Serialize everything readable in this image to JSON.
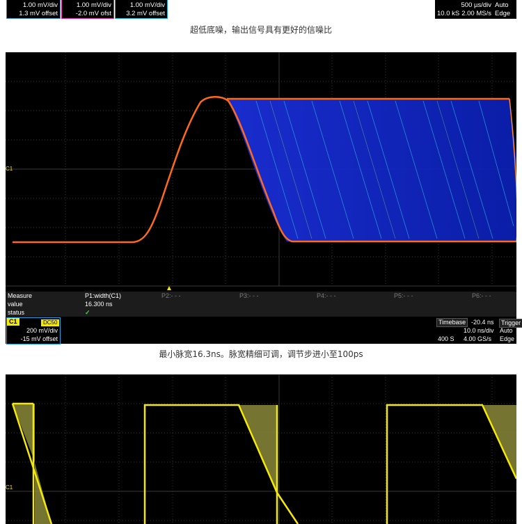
{
  "top_strip": {
    "channels": [
      {
        "line1": "1.00 mV/div",
        "line2": "1.3 mV offset",
        "border": "#3a7bd5"
      },
      {
        "line1": "1.00 mV/div",
        "line2": "-2.0 mV ofst",
        "border": "#e0208a"
      },
      {
        "line1": "1.00 mV/div",
        "line2": "3.2 mV offset",
        "border": "#1fa0e0"
      }
    ],
    "timebase": {
      "div": "500 µs/div",
      "samples": "10.0 kS",
      "rate": "2.00 MS/s",
      "mode": "Auto",
      "trigger": "Edge"
    }
  },
  "caption1": "超低底噪，输出信号具有更好的信噪比",
  "scope1": {
    "c1_marker": "C1",
    "measure": {
      "header_label": "Measure",
      "value_label": "value",
      "status_label": "status",
      "p1": "P1:width(C1)",
      "p1_value": "16.300 ns",
      "p1_status": "✓",
      "others": [
        "P2:- - -",
        "P3:- - -",
        "P4:- - -",
        "P5:- - -",
        "P6:- - -"
      ]
    },
    "channel": {
      "tag": "C1",
      "coupling": "DC50",
      "vdiv": "200 mV/div",
      "offset": "-15 mV offset"
    },
    "timebase": {
      "label": "Timebase",
      "delay": "-20.4 ns",
      "trig_label": "Trigger",
      "div": "10.0 ns/div",
      "mode": "Auto",
      "samples": "400 S",
      "rate": "4.00 GS/s",
      "trigger": "Edge"
    }
  },
  "caption2": "最小脉宽16.3ns。脉宽精细可调，调节步进小至100ps",
  "scope2": {
    "c1_marker": "C1"
  },
  "colors": {
    "trace_yellow": "#f4e80a",
    "persistence_blue": "#1030d0",
    "orange_edge": "#ff6a1a",
    "olive_fill": "#8a8a3a"
  }
}
